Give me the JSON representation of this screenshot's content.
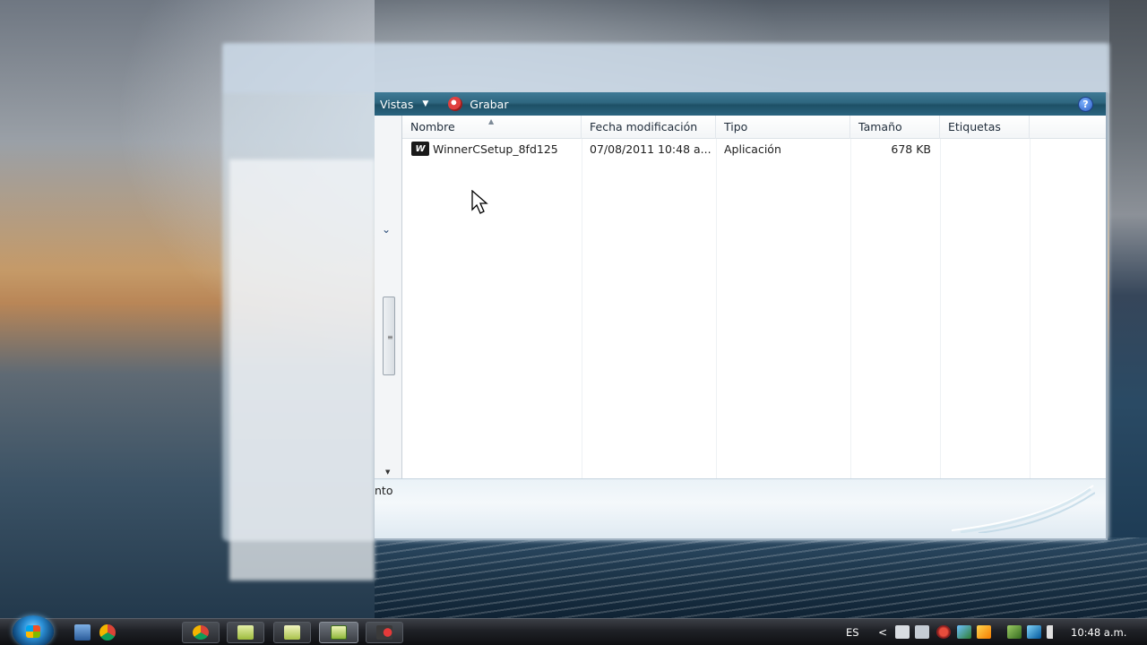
{
  "toolbar": {
    "views_label": "Vistas",
    "burn_label": "Grabar",
    "help_icon": "?"
  },
  "columns": [
    {
      "label": "Nombre"
    },
    {
      "label": "Fecha modificación"
    },
    {
      "label": "Tipo"
    },
    {
      "label": "Tamaño"
    },
    {
      "label": "Etiquetas"
    }
  ],
  "files": [
    {
      "name": "WinnerCSetup_8fd125",
      "modified": "07/08/2011 10:48 a...",
      "type": "Aplicación",
      "size": "678 KB",
      "tags": ""
    }
  ],
  "details": {
    "text_fragment": "nto"
  },
  "taskbar": {
    "language": "ES",
    "tray_expand": "<",
    "clock": "10:48 a.m."
  }
}
